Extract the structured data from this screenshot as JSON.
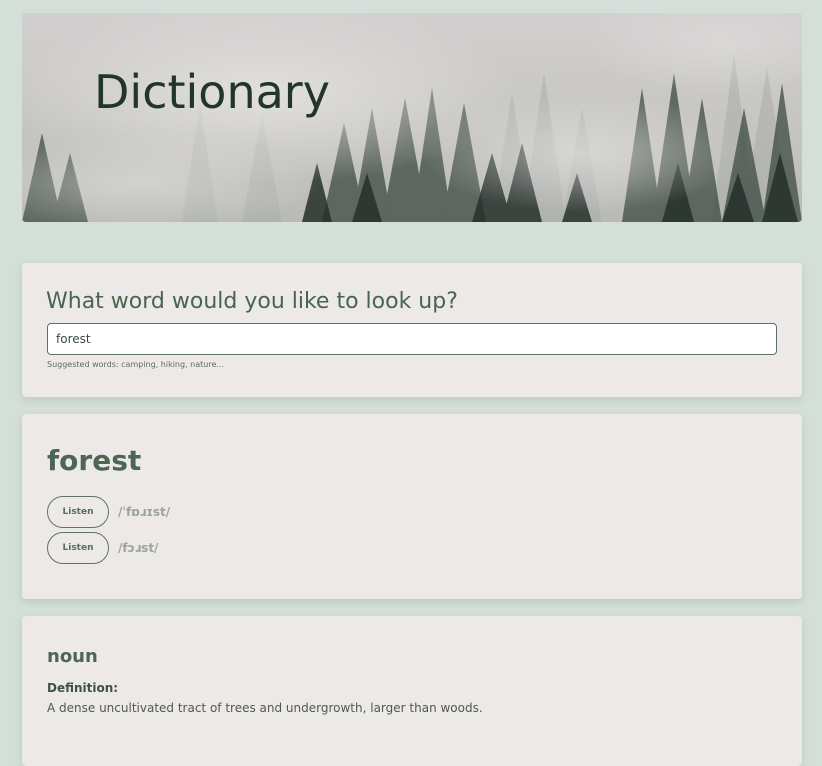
{
  "header": {
    "title": "Dictionary",
    "image": "misty-forest-background"
  },
  "search": {
    "heading": "What word would you like to look up?",
    "value": "forest",
    "hint": "Suggested words: camping, hiking, nature..."
  },
  "result": {
    "word": "forest",
    "phonetics": [
      {
        "button": "Listen",
        "text": "/ˈfɒɹɪst/"
      },
      {
        "button": "Listen",
        "text": "/fɔɹst/"
      }
    ]
  },
  "meaning": {
    "part_of_speech": "noun",
    "definition_label": "Definition:",
    "definition": "A dense uncultivated tract of trees and undergrowth, larger than woods."
  }
}
